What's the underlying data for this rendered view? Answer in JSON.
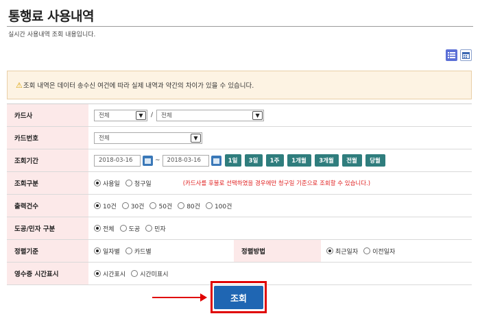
{
  "header": {
    "title": "통행료 사용내역",
    "subtitle": "실시간 사용내역 조회 내용입니다."
  },
  "notice": {
    "icon": "warning-icon",
    "text": "조회 내역은 데이터 송수신 여건에 따라 실제 내역과 약간의 차이가 있을 수 있습니다."
  },
  "form": {
    "card_company": {
      "label": "카드사",
      "select1": "전체",
      "select2": "전체"
    },
    "card_number": {
      "label": "카드번호",
      "select": "전체"
    },
    "period": {
      "label": "조회기간",
      "start": "2018-03-16",
      "end": "2018-03-16",
      "presets": [
        "1일",
        "3일",
        "1주",
        "1개월",
        "3개월",
        "전월",
        "당월"
      ]
    },
    "query_type": {
      "label": "조회구분",
      "options": [
        "사용일",
        "청구일"
      ],
      "note": "(카드사를 후불로 선택하였을 경우에만 청구일 기준으로 조회할 수 있습니다.)"
    },
    "output_count": {
      "label": "출력건수",
      "options": [
        "10건",
        "30건",
        "50건",
        "80건",
        "100건"
      ]
    },
    "public_private": {
      "label": "도공/민자 구분",
      "options": [
        "전체",
        "도공",
        "민자"
      ]
    },
    "sort_criteria": {
      "label": "정렬기준",
      "options": [
        "일자별",
        "카드별"
      ]
    },
    "sort_method": {
      "label": "정렬방법",
      "options": [
        "최근일자",
        "이전일자"
      ]
    },
    "receipt_time": {
      "label": "영수증 시간표시",
      "options": [
        "시간표시",
        "시간미표시"
      ]
    }
  },
  "search_button": "조회",
  "colors": {
    "label_bg": "#fce9e9",
    "preset_button": "#2f7d7d",
    "search_button": "#1f66b3",
    "highlight": "#e00000"
  }
}
